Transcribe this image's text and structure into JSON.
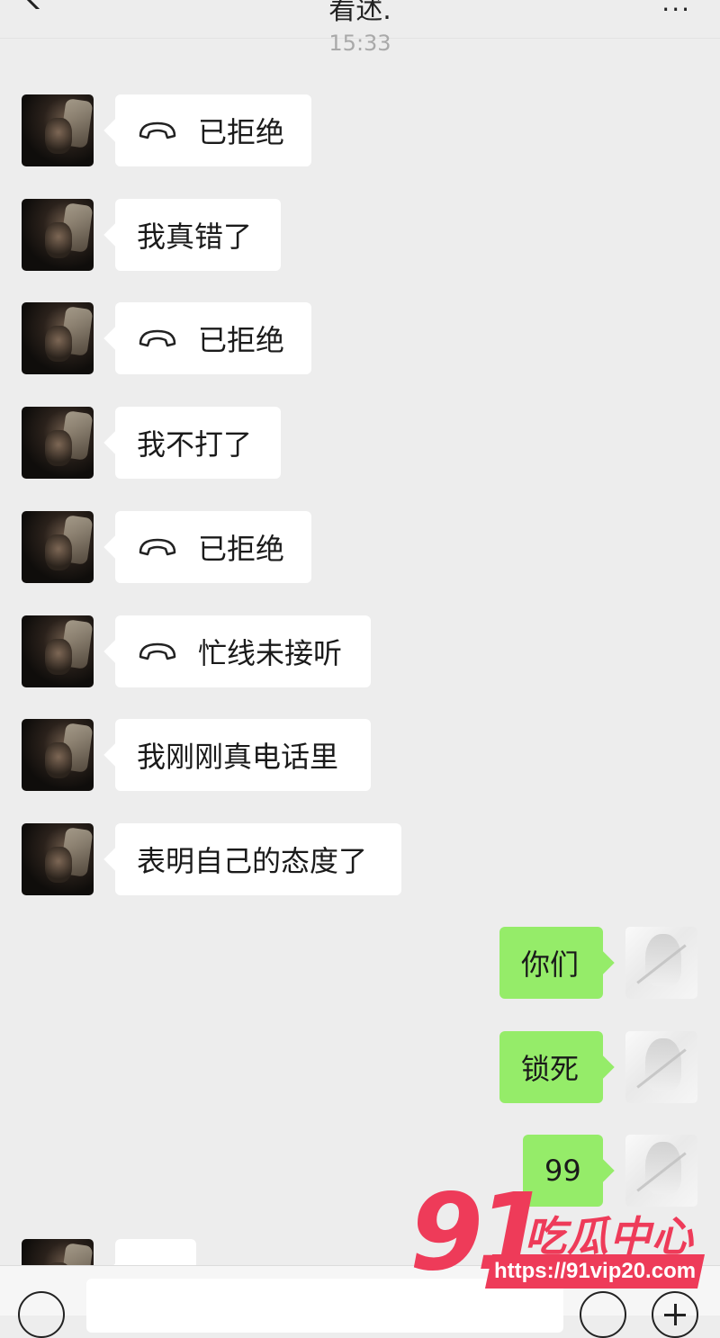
{
  "header": {
    "title": "看述.",
    "more_label": "···"
  },
  "timestamp": "15:33",
  "messages": [
    {
      "side": "left",
      "type": "call",
      "text": "已拒绝"
    },
    {
      "side": "left",
      "type": "text",
      "text": "我真错了"
    },
    {
      "side": "left",
      "type": "call",
      "text": "已拒绝"
    },
    {
      "side": "left",
      "type": "text",
      "text": "我不打了"
    },
    {
      "side": "left",
      "type": "call",
      "text": "已拒绝"
    },
    {
      "side": "left",
      "type": "call",
      "text": "忙线未接听"
    },
    {
      "side": "left",
      "type": "text",
      "text": "我刚刚真电话里"
    },
    {
      "side": "left",
      "type": "text",
      "text": "表明自己的态度了"
    },
    {
      "side": "right",
      "type": "text",
      "text": "你们"
    },
    {
      "side": "right",
      "type": "text",
      "text": "锁死"
    },
    {
      "side": "right",
      "type": "text",
      "text": "99"
    },
    {
      "side": "left",
      "type": "text",
      "text": ""
    }
  ],
  "input": {
    "placeholder": ""
  },
  "watermark": {
    "number": "91",
    "name": "吃瓜中心",
    "url": "https://91vip20.com"
  },
  "colors": {
    "background": "#ededed",
    "incoming_bubble": "#ffffff",
    "outgoing_bubble": "#95ec69",
    "watermark": "#ee3b59"
  },
  "icons": {
    "call": "call-declined-icon",
    "back": "back-chevron-icon",
    "voice": "voice-icon",
    "emoji": "emoji-icon",
    "plus": "plus-icon"
  }
}
